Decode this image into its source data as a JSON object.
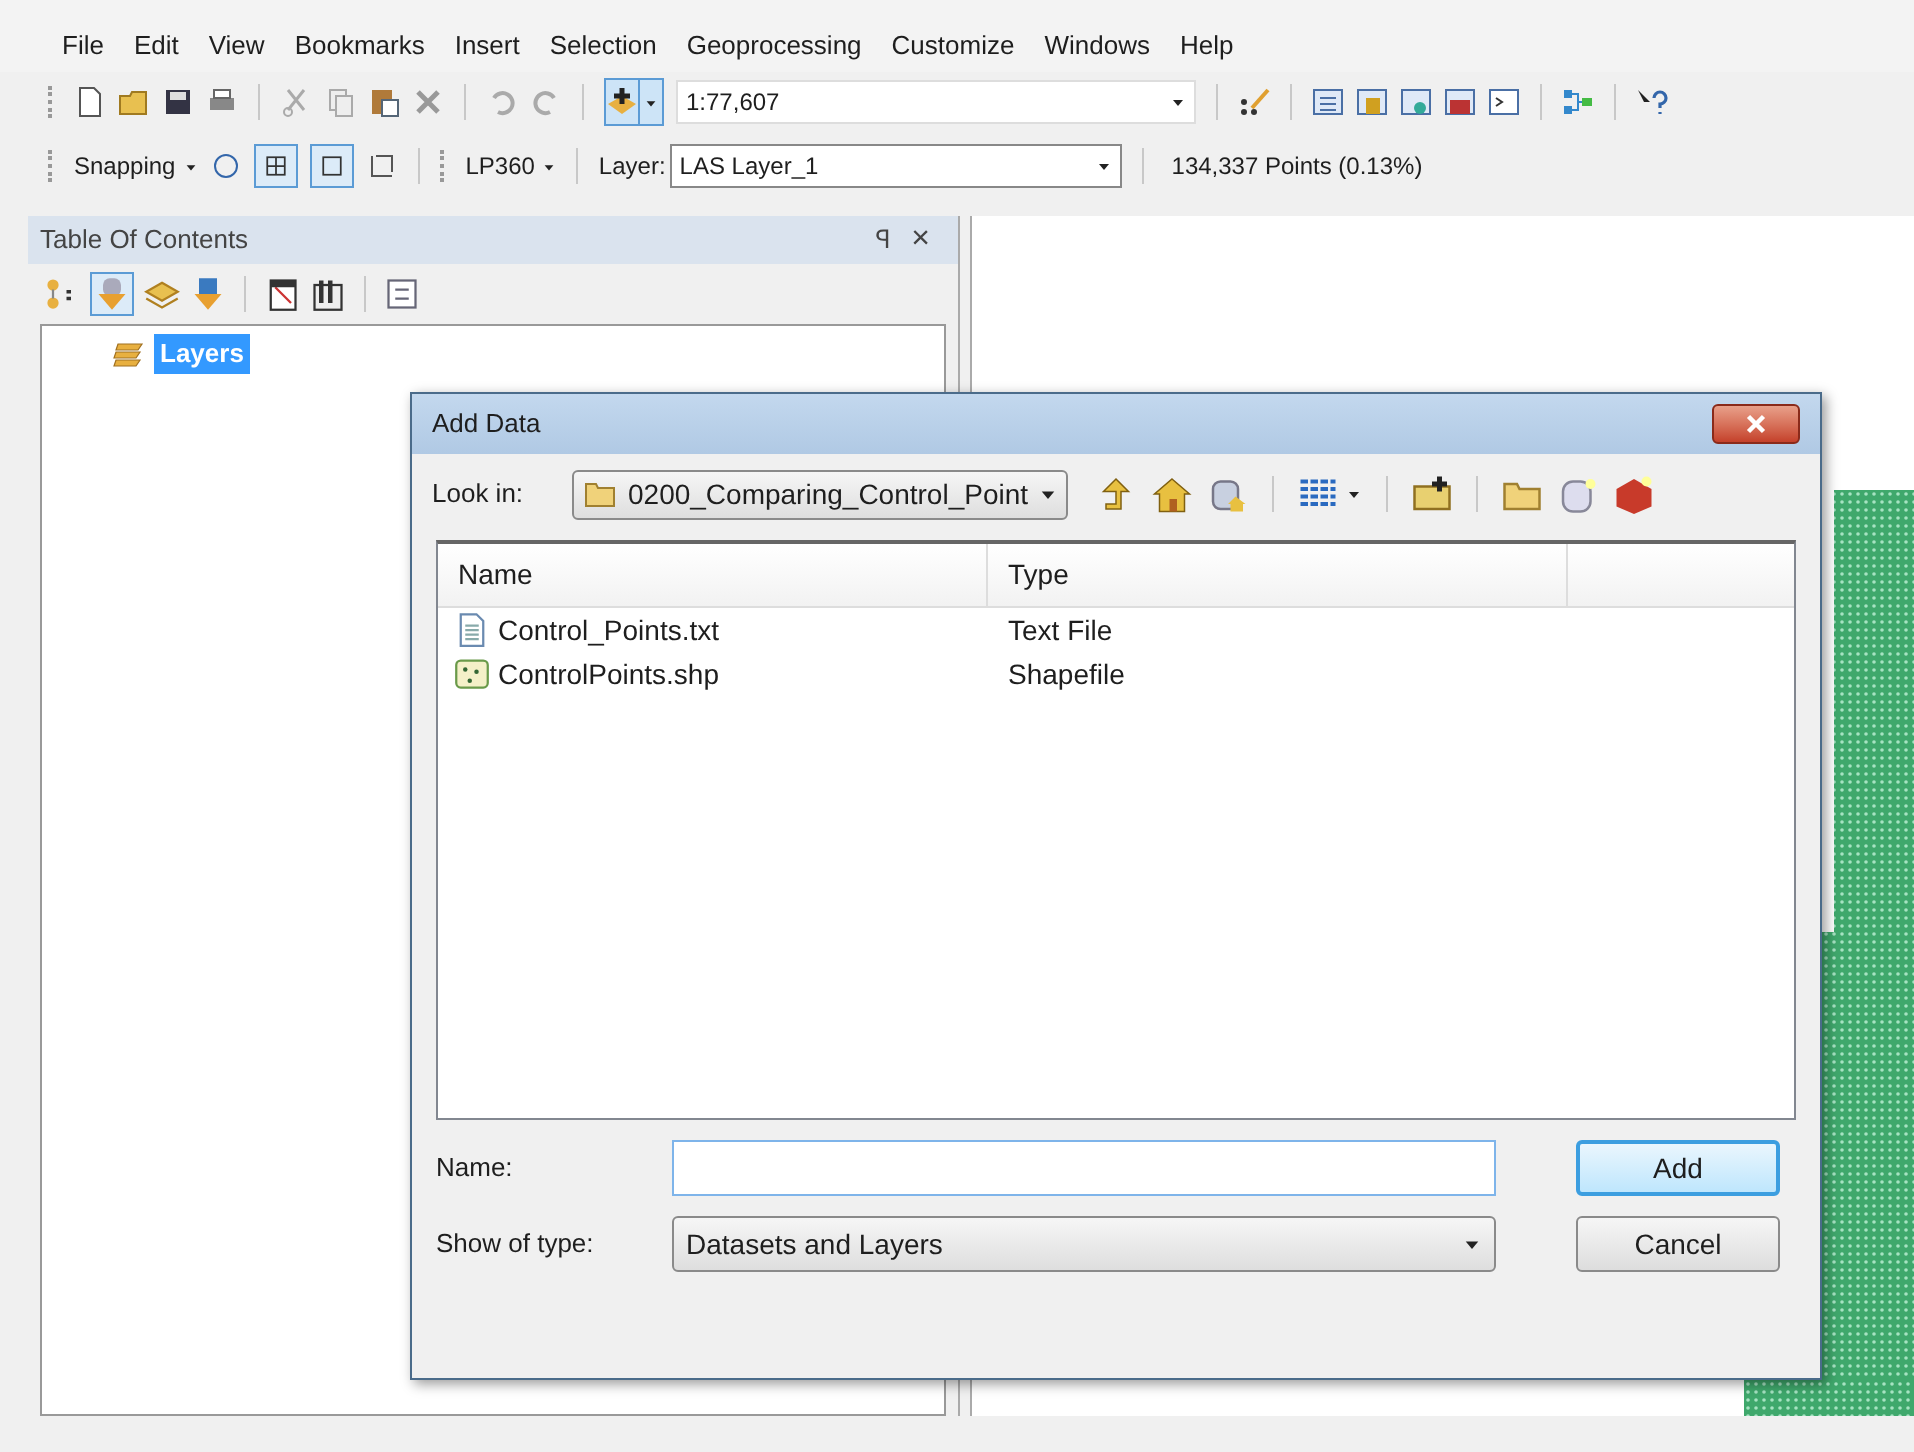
{
  "menu": [
    "File",
    "Edit",
    "View",
    "Bookmarks",
    "Insert",
    "Selection",
    "Geoprocessing",
    "Customize",
    "Windows",
    "Help"
  ],
  "toolbar": {
    "scale": "1:77,607"
  },
  "snapping_toolbar": {
    "snapping": "Snapping",
    "lp360": "LP360",
    "layer_label": "Layer:",
    "layer_value": "LAS Layer_1",
    "points": "134,337 Points (0.13%)"
  },
  "toc": {
    "title": "Table Of Contents",
    "pin": "ꟼ",
    "close": "×",
    "items": [
      {
        "label": "Layers",
        "selected": true
      }
    ]
  },
  "dialog": {
    "title": "Add Data",
    "look_in_label": "Look in:",
    "look_in_value": "0200_Comparing_Control_Point",
    "columns": [
      "Name",
      "Type"
    ],
    "rows": [
      {
        "kind": "text",
        "name": "Control_Points.txt",
        "type": "Text File",
        "selected": false
      },
      {
        "kind": "shapefile",
        "name": "ControlPoints.shp",
        "type": "Shapefile",
        "selected": false
      }
    ],
    "name_label": "Name:",
    "type_label": "Show of type:",
    "type_value": "Datasets and Layers",
    "buttons": [
      {
        "label": "Add",
        "default": true
      },
      {
        "label": "Cancel",
        "default": false
      }
    ]
  }
}
